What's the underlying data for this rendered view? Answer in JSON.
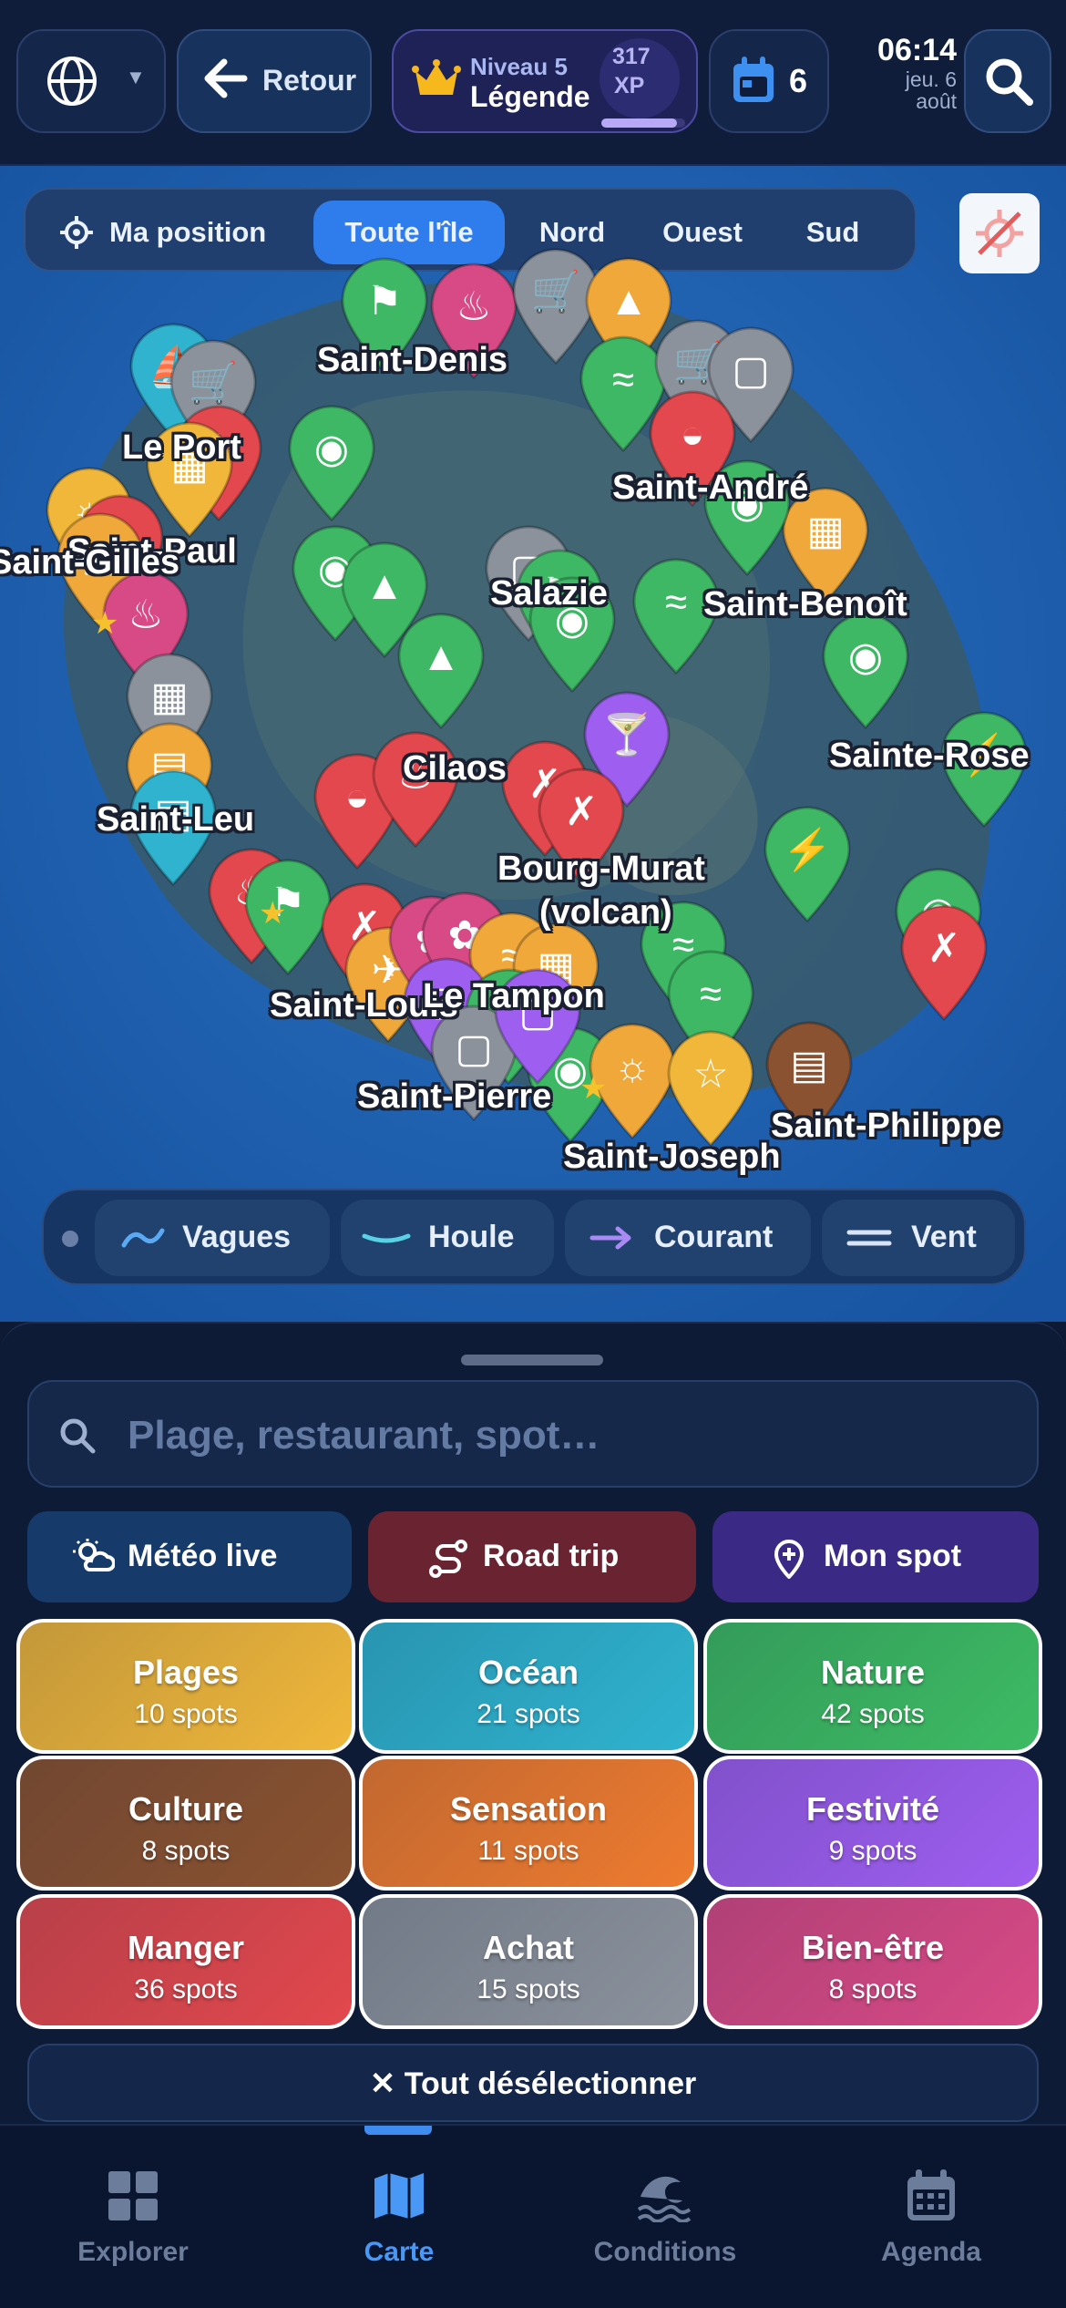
{
  "topbar": {
    "back_label": "Retour",
    "level_label": "Niveau 5",
    "rank_label": "Légende",
    "xp_value": "317",
    "xp_unit": "XP",
    "xp_progress": 0.9,
    "events_count": "6",
    "time": "06:14",
    "date_line1": "jeu. 6",
    "date_line2": "août"
  },
  "map": {
    "filters": [
      {
        "label": "Ma position",
        "active": false
      },
      {
        "label": "Toute l'île",
        "active": true
      },
      {
        "label": "Nord",
        "active": false
      },
      {
        "label": "Ouest",
        "active": false
      },
      {
        "label": "Sud",
        "active": false
      }
    ],
    "cities": {
      "saint_denis": "Saint-Denis",
      "le_port": "Le Port",
      "saint_paul": "Saint-Paul",
      "saint_gilles": "Saint-Gilles",
      "saint_andre": "Saint-André",
      "salazie": "Salazie",
      "saint_benoit": "Saint-Benoît",
      "sainte_rose": "Sainte-Rose",
      "cilaos": "Cilaos",
      "saint_leu": "Saint-Leu",
      "bourg_murat_1": "Bourg-Murat",
      "bourg_murat_2": "(volcan)",
      "saint_louis": "Saint-Louis",
      "le_tampon": "Le Tampon",
      "saint_pierre": "Saint-Pierre",
      "saint_joseph": "Saint-Joseph",
      "saint_philippe": "Saint-Philippe"
    },
    "layers": [
      {
        "label": "Vagues",
        "icon": "wave-icon"
      },
      {
        "label": "Houle",
        "icon": "swell-icon"
      },
      {
        "label": "Courant",
        "icon": "current-arrow-icon"
      },
      {
        "label": "Vent",
        "icon": "wind-icon"
      }
    ]
  },
  "sheet": {
    "search_placeholder": "Plage, restaurant, spot…",
    "actions": {
      "meteo": "Météo live",
      "roadtrip": "Road trip",
      "myspot": "Mon spot"
    },
    "categories": [
      {
        "name": "Plages",
        "count": "10 spots",
        "color": "#f0b73a"
      },
      {
        "name": "Océan",
        "count": "21 spots",
        "color": "#2fb3cf"
      },
      {
        "name": "Nature",
        "count": "42 spots",
        "color": "#3dbb63"
      },
      {
        "name": "Culture",
        "count": "8 spots",
        "color": "#8a5230"
      },
      {
        "name": "Sensation",
        "count": "11 spots",
        "color": "#ee7b2f"
      },
      {
        "name": "Festivité",
        "count": "9 spots",
        "color": "#9e5ef0"
      },
      {
        "name": "Manger",
        "count": "36 spots",
        "color": "#e2484d"
      },
      {
        "name": "Achat",
        "count": "15 spots",
        "color": "#8b929c"
      },
      {
        "name": "Bien-être",
        "count": "8 spots",
        "color": "#d84a86"
      }
    ],
    "deselect_label": "Tout désélectionner"
  },
  "nav": {
    "items": [
      {
        "label": "Explorer",
        "icon": "grid-icon",
        "active": false
      },
      {
        "label": "Carte",
        "icon": "map-icon",
        "active": true
      },
      {
        "label": "Conditions",
        "icon": "waves-icon",
        "active": false
      },
      {
        "label": "Agenda",
        "icon": "calendar-icon",
        "active": false
      }
    ]
  }
}
